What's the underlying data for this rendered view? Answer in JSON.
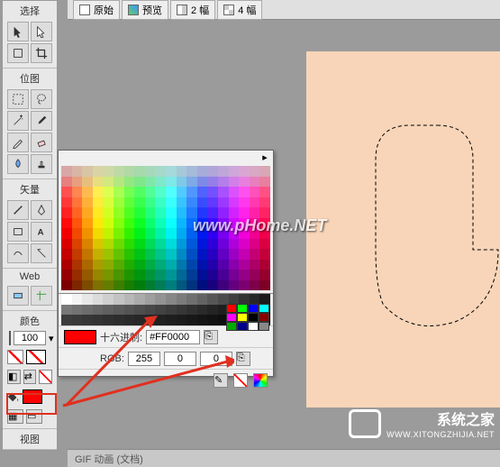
{
  "tool_panel": {
    "sections": {
      "select": "选择",
      "bitmap": "位图",
      "vector": "矢量",
      "web": "Web",
      "colors": "颜色",
      "view": "视图"
    },
    "opacity_value": "100"
  },
  "top_tabs": {
    "original": "原始",
    "preview": "预览",
    "two_up": "2 幅",
    "four_up": "4 幅"
  },
  "color_picker": {
    "hex_label": "十六进制:",
    "hex_value": "#FF0000",
    "rgb_label": "RGB:",
    "r": "255",
    "g": "0",
    "b": "0"
  },
  "status": "GIF 动画 (文档)",
  "watermark1": "www.pHome.NET",
  "watermark2": {
    "name": "系统之家",
    "url": "WWW.XITONGZHIJIA.NET"
  }
}
